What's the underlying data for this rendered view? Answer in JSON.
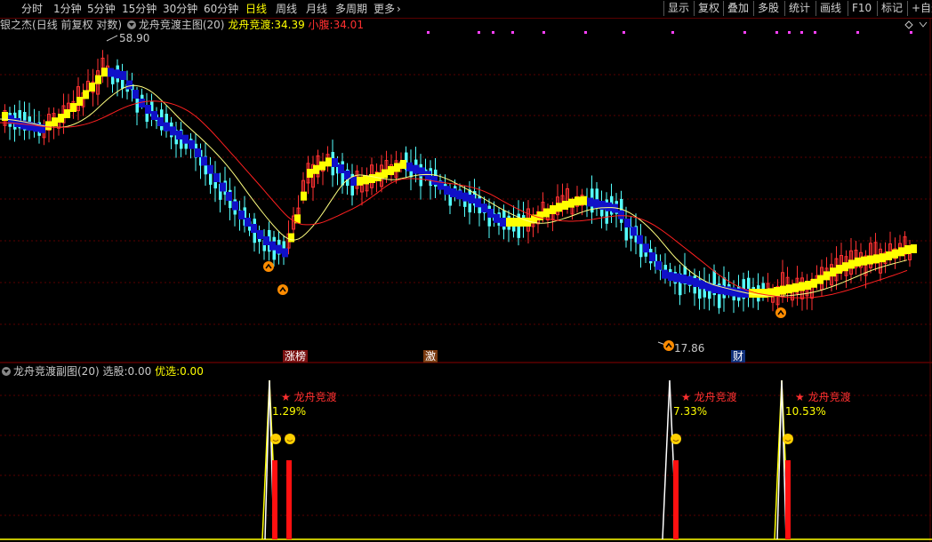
{
  "toolbar": {
    "periods": [
      "分时",
      "1分钟",
      "5分钟",
      "15分钟",
      "30分钟",
      "60分钟",
      "日线",
      "周线",
      "月线",
      "多周期"
    ],
    "active_period": "日线",
    "more_label": "更多",
    "more_icon": "chevron-right-icon",
    "right_buttons": [
      "显示",
      "复权",
      "叠加",
      "多股",
      "统计",
      "画线",
      "F10",
      "标记",
      "+自选"
    ]
  },
  "main_header": {
    "stock_name": "银之杰",
    "chart_mode": "(日线 前复权 对数)",
    "indicator": "龙舟竞渡主图(20)",
    "indicator_icon": "circle-down-icon",
    "line1_label": "龙舟竞渡:",
    "line1_value": "34.39",
    "line2_label": "小腹:",
    "line2_value": "34.01"
  },
  "annotations": {
    "high_price": "58.90",
    "low_price": "17.86",
    "tag_zhangting": "涨榜",
    "tag_ji": "激",
    "tag_cai": "财"
  },
  "sub_header": {
    "indicator": "龙舟竞渡副图(20)",
    "indicator_icon": "circle-down-icon",
    "xuangu_label": "选股:",
    "xuangu_value": "0.00",
    "youxuan_label": "优选:",
    "youxuan_value": "0.00"
  },
  "signals": [
    {
      "label": "★ 龙舟竞渡",
      "pct": "1.29%"
    },
    {
      "label": "★ 龙舟竞渡",
      "pct": "7.33%"
    },
    {
      "label": "★ 龙舟竞渡",
      "pct": "10.53%"
    }
  ],
  "colors": {
    "background": "#000000",
    "up": "#ff3232",
    "down": "#54ffff",
    "boat_up": "#ffff00",
    "boat_down": "#1010c8",
    "ma_fast": "#ffff80",
    "ma_slow": "#ff2020",
    "grid": "#5a0000"
  }
}
